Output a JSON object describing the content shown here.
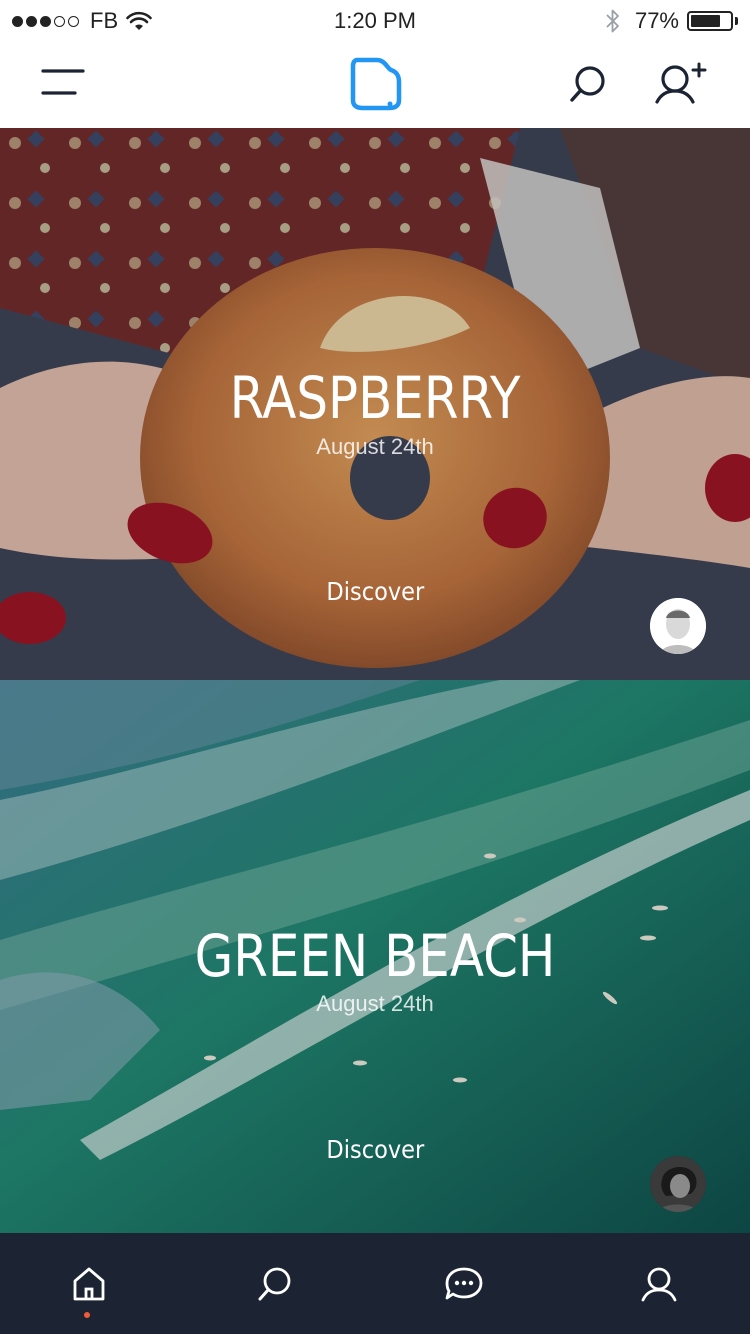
{
  "status_bar": {
    "carrier": "FB",
    "time": "1:20 PM",
    "battery_percent": "77%",
    "battery_level": 0.77,
    "signal_bars": 3,
    "signal_total": 5
  },
  "nav": {
    "icons": [
      "menu-icon",
      "app-logo-icon",
      "search-icon",
      "add-user-icon"
    ],
    "accent_color": "#2196f3"
  },
  "cards": [
    {
      "title": "RASPBERRY",
      "date": "August 24th",
      "link": "Discover"
    },
    {
      "title": "GREEN BEACH",
      "date": "August 24th",
      "link": "Discover"
    }
  ],
  "tab_bar": {
    "tabs": [
      "home-icon",
      "search-icon",
      "chat-icon",
      "profile-icon"
    ],
    "active_tab": "home",
    "background": "#1c2433",
    "active_indicator_color": "#f25a3a"
  }
}
